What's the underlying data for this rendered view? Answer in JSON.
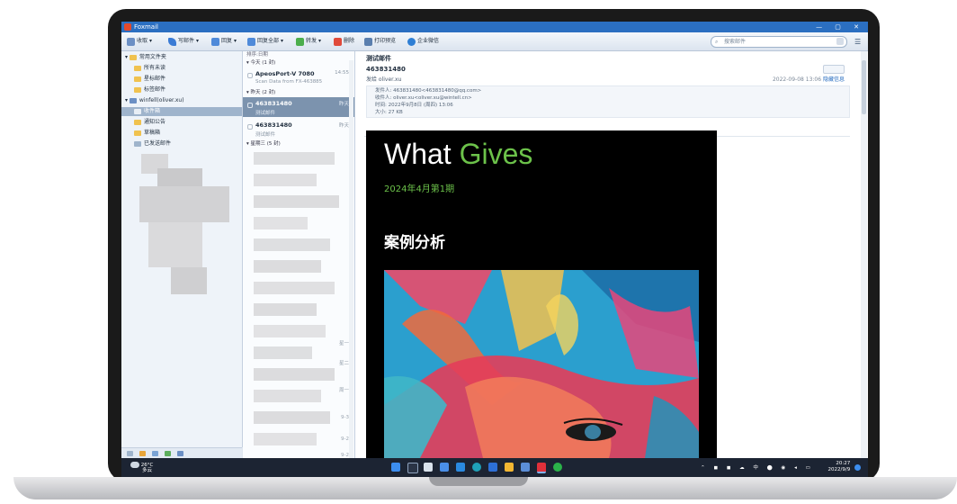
{
  "window": {
    "title": "Foxmail"
  },
  "toolbar": {
    "receive": "收取",
    "compose": "写邮件",
    "reply": "回复",
    "reply_all": "回复全部",
    "forward": "转发",
    "delete": "删除",
    "print_preview": "打印预览",
    "enterprise": "企业微信",
    "search_placeholder": "搜索邮件"
  },
  "folders": {
    "common": "常用文件夹",
    "unread": "所有未读",
    "starred": "星标邮件",
    "flagged": "标签邮件",
    "account": "winfell(oliver.xu)",
    "inbox": "收件箱",
    "notices": "通知公告",
    "drafts": "草稿箱",
    "sent": "已发送邮件"
  },
  "list": {
    "sort_label": "排序:日期",
    "group_today": "今天 (1 封)",
    "group_yesterday": "昨天 (2 封)",
    "group_wed": "星期三 (5 封)",
    "items": [
      {
        "from": "ApeosPort-V 7080",
        "subject": "Scan Data from FX-463885",
        "time": "14:55"
      },
      {
        "from": "463831480",
        "subject": "测试邮件",
        "time": "昨天"
      },
      {
        "from": "463831480",
        "subject": "测试邮件",
        "time": "昨天"
      }
    ],
    "blurred_dates": [
      "星一",
      "星二",
      "周一",
      "9-3",
      "9-2",
      "9-2"
    ]
  },
  "reader": {
    "subject": "测试邮件",
    "sender": "463831480",
    "to_line": "发给 oliver.xu",
    "date": "2022-09-08 13:06",
    "detail_link": "隐藏信息",
    "from_detail": "发件人: 463831480<463831480@qq.com>",
    "to_detail": "收件人: oliver.xu<oliver.xu@wintell.cn>",
    "time_detail": "时间: 2022年9月8日 (周四) 13:06",
    "size_detail": "大小: 27 KB"
  },
  "newsletter": {
    "title_a": "What",
    "title_b": "Gives",
    "issue": "2024年4月第1期",
    "section": "案例分析"
  },
  "taskbar": {
    "temp": "26°C",
    "weather": "多云",
    "time": "20:27",
    "date": "2022/9/9"
  },
  "colors": {
    "accent_green": "#6cc24a",
    "titlebar_blue": "#2b6fc1"
  }
}
